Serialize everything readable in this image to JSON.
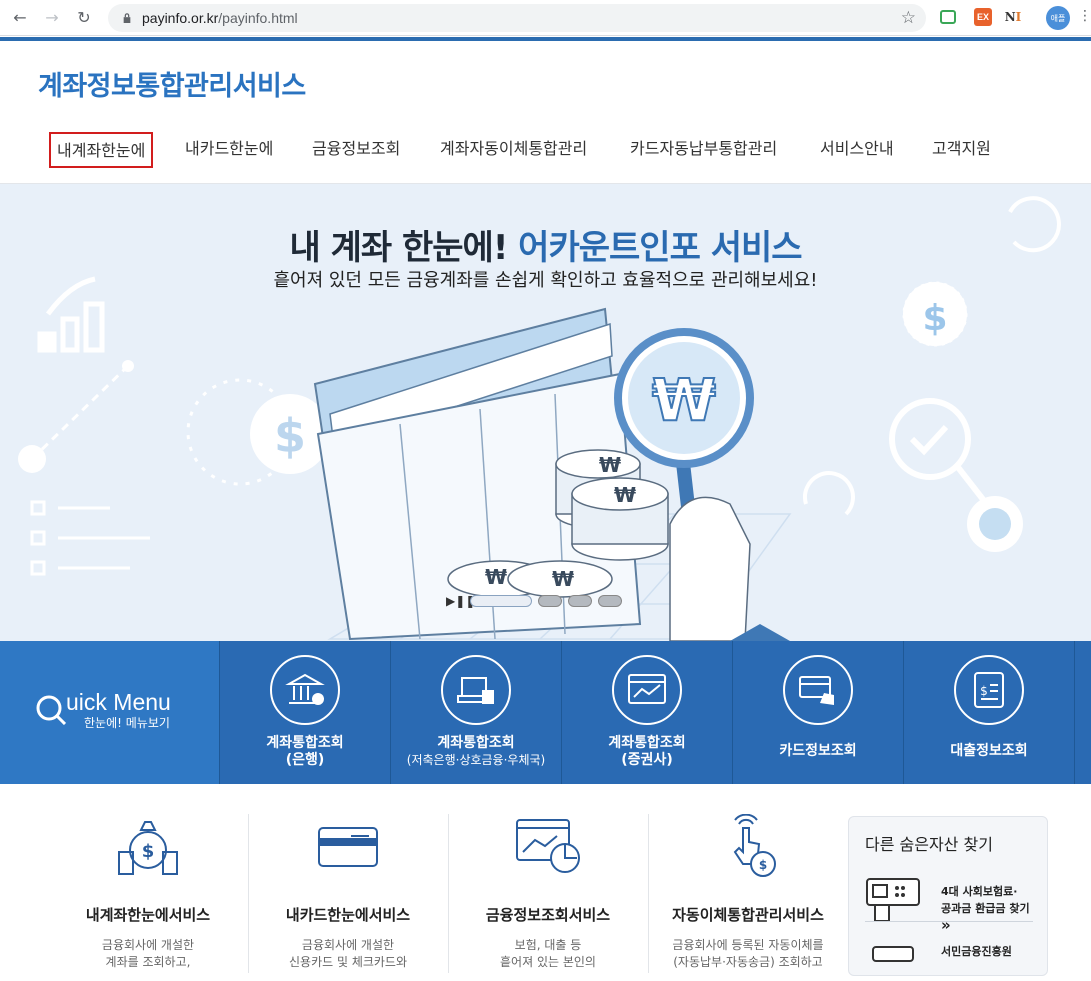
{
  "browser": {
    "url_host": "payinfo.or.kr",
    "url_path": "/payinfo.html",
    "profile_label": "애플"
  },
  "site": {
    "logo": "계좌정보통합관리서비스",
    "gnb": [
      {
        "label": "내계좌한눈에"
      },
      {
        "label": "내카드한눈에"
      },
      {
        "label": "금융정보조회"
      },
      {
        "label": "계좌자동이체통합관리"
      },
      {
        "label": "카드자동납부통합관리"
      },
      {
        "label": "서비스안내"
      },
      {
        "label": "고객지원"
      }
    ]
  },
  "hero": {
    "title_black": "내 계좌 한눈에! ",
    "title_blue": "어카운트인포 서비스",
    "subtitle": "흩어져 있던 모든 금융계좌를 손쉽게 확인하고 효율적으로 관리해보세요!"
  },
  "quick_menu": {
    "title": "uick Menu",
    "subtitle": "한눈에! 메뉴보기",
    "items": [
      {
        "line1": "계좌통합조회",
        "line2": "(은행)"
      },
      {
        "line1": "계좌통합조회",
        "line2": "(저축은행·상호금융·우체국)"
      },
      {
        "line1": "계좌통합조회",
        "line2": "(증권사)"
      },
      {
        "line1": "카드정보조회",
        "line2": ""
      },
      {
        "line1": "대출정보조회",
        "line2": ""
      }
    ]
  },
  "services": [
    {
      "title": "내계좌한눈에서비스",
      "desc1": "금융회사에 개설한",
      "desc2": "계좌를 조회하고,"
    },
    {
      "title": "내카드한눈에서비스",
      "desc1": "금융회사에 개설한",
      "desc2": "신용카드 및 체크카드와"
    },
    {
      "title": "금융정보조회서비스",
      "desc1": "보험, 대출 등",
      "desc2": "흩어져 있는 본인의"
    },
    {
      "title": "자동이체통합관리서비스",
      "desc1": "금융회사에 등록된 자동이체를",
      "desc2": "(자동납부·자동송금) 조회하고"
    }
  ],
  "side_box": {
    "title": "다른 숨은자산 찾기",
    "item1_line1": "4대 사회보험료·",
    "item1_line2": "공과금 환급금 찾기",
    "item1_arrow": "»",
    "item2_line1": "서민금융진흥원"
  },
  "colors": {
    "brand_blue": "#2a73c0",
    "quick_bg": "#2a6ab3",
    "active_border": "#d21d1d"
  }
}
